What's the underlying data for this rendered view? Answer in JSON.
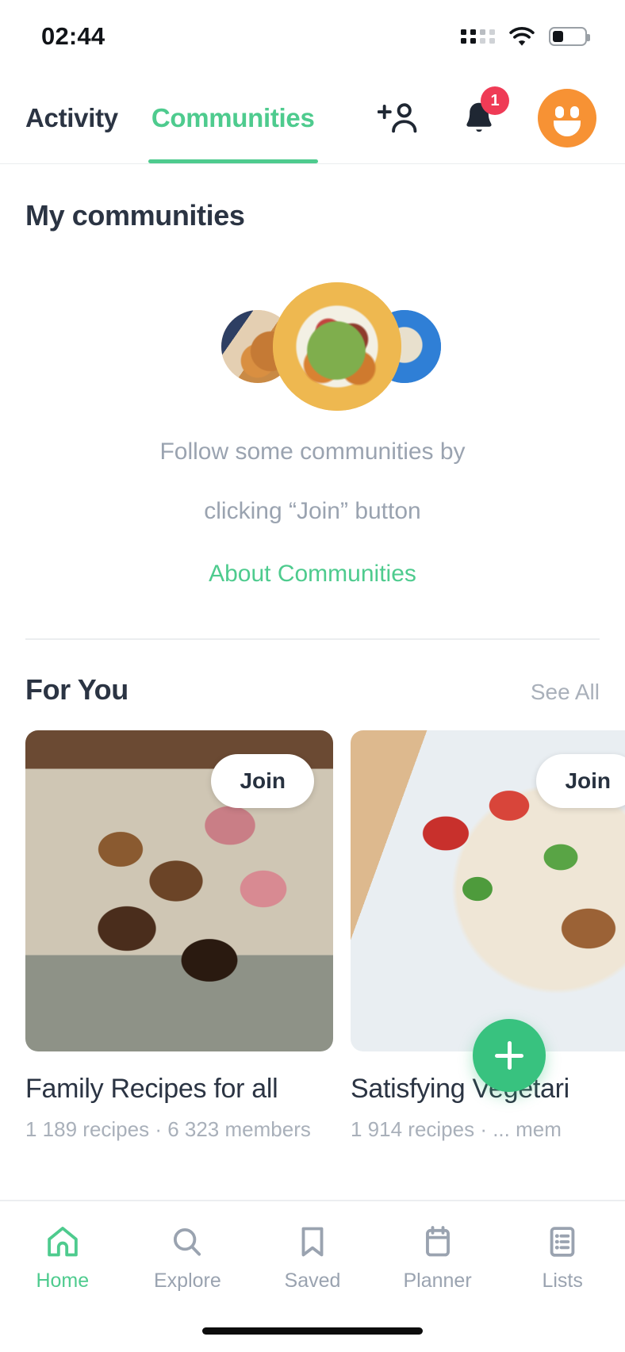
{
  "status_bar": {
    "time": "02:44",
    "signal_icon": "signal-dots-icon",
    "wifi_icon": "wifi-icon",
    "battery_icon": "battery-icon",
    "battery_level_pct": 35
  },
  "top_bar": {
    "tabs": [
      {
        "label": "Activity",
        "active": false
      },
      {
        "label": "Communities",
        "active": true
      }
    ],
    "actions": [
      {
        "name": "add-person-icon"
      },
      {
        "name": "notifications-bell-icon",
        "badge": "1"
      },
      {
        "name": "avatar"
      }
    ],
    "notification_count": "1"
  },
  "my_communities": {
    "title": "My communities",
    "empty_line1": "Follow some communities by",
    "empty_line2": "clicking “Join” button",
    "about_link": "About Communities",
    "illustration": {
      "left_circle": "food-photo-left",
      "center_circle": "food-photo-center",
      "right_circle": "food-photo-right"
    }
  },
  "for_you": {
    "title": "For You",
    "see_all": "See All",
    "cards": [
      {
        "title": "Family Recipes for all",
        "meta": "1 189 recipes · 6 323 members",
        "join_label": "Join",
        "image": "lamb-chops-photo"
      },
      {
        "title": "Satisfying Vegetari",
        "meta": "1 914 recipes · ... mem",
        "join_label": "Join",
        "image": "vegetarian-salad-photo"
      }
    ]
  },
  "fab": {
    "name": "create-recipe-button",
    "glyph": "+"
  },
  "bottom_nav": {
    "items": [
      {
        "label": "Home",
        "icon": "home-icon",
        "active": true
      },
      {
        "label": "Explore",
        "icon": "search-icon",
        "active": false
      },
      {
        "label": "Saved",
        "icon": "bookmark-icon",
        "active": false
      },
      {
        "label": "Planner",
        "icon": "calendar-icon",
        "active": false
      },
      {
        "label": "Lists",
        "icon": "list-icon",
        "active": false
      }
    ]
  },
  "colors": {
    "accent_green": "#4ecb8e",
    "fab_green": "#38c27f",
    "text_dark": "#2b3443",
    "text_muted": "#9aa3b0",
    "badge_red": "#ef3b56",
    "avatar_orange": "#f79234"
  }
}
